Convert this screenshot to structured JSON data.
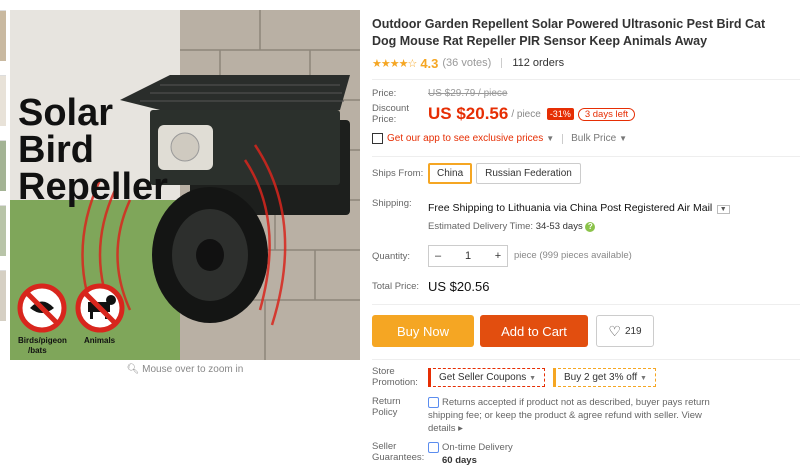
{
  "product": {
    "title": "Outdoor Garden Repellent Solar Powered Ultrasonic Pest Bird Cat Dog Mouse Rat Repeller PIR Sensor Keep Animals Away",
    "rating_stars": "★★★★☆",
    "rating": "4.3",
    "votes": "(36 votes)",
    "orders": "112 orders"
  },
  "image": {
    "banner_line1": "Solar",
    "banner_line2": "Bird",
    "banner_line3": "Repeller",
    "icon1_label": "Birds/pigeon\n/bats",
    "icon2_label": "Animals",
    "zoom_hint": "Mouse over to zoom in"
  },
  "price": {
    "price_label": "Price:",
    "original": "US $29.79 / piece",
    "discount_label": "Discount Price:",
    "discount": "US $20.56",
    "unit": "/ piece",
    "percent_off": "-31%",
    "days_left": "3 days left",
    "app_text": "Get our app to see exclusive prices",
    "bulk": "Bulk Price"
  },
  "shipping": {
    "ships_from_label": "Ships From:",
    "options": [
      "China",
      "Russian Federation"
    ],
    "selected": "China",
    "shipping_label": "Shipping:",
    "shipping_text": "Free Shipping to Lithuania via China Post Registered Air Mail",
    "delivery_label": "Estimated Delivery Time:",
    "delivery_value": "34-53 days"
  },
  "quantity": {
    "label": "Quantity:",
    "value": "1",
    "available": "piece (999 pieces available)"
  },
  "total": {
    "label": "Total Price:",
    "value": "US $20.56"
  },
  "actions": {
    "buy_now": "Buy Now",
    "add_to_cart": "Add to Cart",
    "wishlist_count": "219"
  },
  "promotion": {
    "label": "Store Promotion:",
    "coupon1": "Get Seller Coupons",
    "coupon2": "Buy 2 get 3% off"
  },
  "return_policy": {
    "label": "Return Policy",
    "text": "Returns accepted if product not as described, buyer pays return shipping fee; or keep the product & agree refund with seller.",
    "link": "View details"
  },
  "guarantees": {
    "label": "Seller Guarantees:",
    "item": "On-time Delivery",
    "days": "60 days"
  },
  "colors": {
    "accent_red": "#e62e04",
    "orange": "#f5a623",
    "cart": "#e24e0f"
  }
}
